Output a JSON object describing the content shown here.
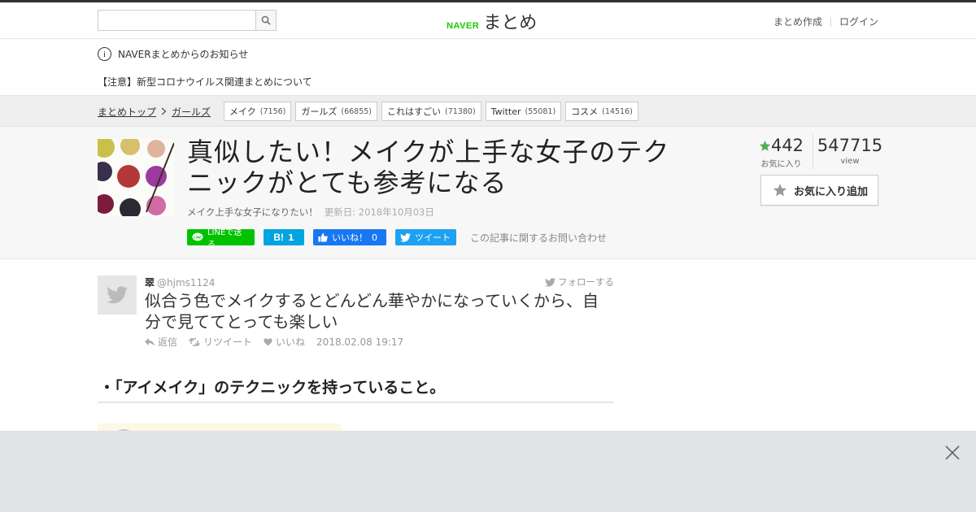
{
  "header": {
    "search_placeholder": "",
    "logo_brand": "NAVER",
    "logo_text": "まとめ",
    "link_create": "まとめ作成",
    "link_login": "ログイン"
  },
  "notice": {
    "info_text": "NAVERまとめからのお知らせ",
    "alert_text": "【注意】新型コロナウイルス関連まとめについて"
  },
  "breadcrumb": {
    "top": "まとめトップ",
    "current": "ガールズ"
  },
  "tags": [
    {
      "label": "メイク",
      "count": "(7156)"
    },
    {
      "label": "ガールズ",
      "count": "(66855)"
    },
    {
      "label": "これはすごい",
      "count": "(71380)"
    },
    {
      "label": "Twitter",
      "count": "(55081)"
    },
    {
      "label": "コスメ",
      "count": "(14516)"
    }
  ],
  "article": {
    "title": "真似したい！メイクが上手な女子のテクニックがとても参考になる",
    "subtitle": "メイク上手な女子になりたい！",
    "updated": "更新日: 2018年10月03日",
    "favorites": "442",
    "favorites_label": "お気に入り",
    "views": "547715",
    "views_label": "view",
    "fav_button": "お気に入り追加"
  },
  "share": {
    "line": "LINEで送る",
    "hatena_count": "1",
    "fb_label": "いいね！",
    "fb_count": "0",
    "tweet": "ツイート",
    "inquiry": "この記事に関するお問い合わせ"
  },
  "tweet": {
    "name": "翠",
    "handle": "@hjms1124",
    "follow": "フォローする",
    "text": "似合う色でメイクするとどんどん華やかになっていくから、自分で見ててとっても楽しい",
    "reply": "返信",
    "retweet": "リツイート",
    "like": "いいね",
    "timestamp": "2018.02.08 19:17"
  },
  "section_heading": "・「アイメイク」のテクニックを持っていること。",
  "colors": {
    "naver_green": "#1ec800",
    "line_green": "#00c300",
    "hatena_blue": "#00a4de",
    "facebook_blue": "#1877f2",
    "twitter_blue": "#1da1f2",
    "star_green": "#4caf50",
    "overlay_gray": "#e1e4e6"
  }
}
